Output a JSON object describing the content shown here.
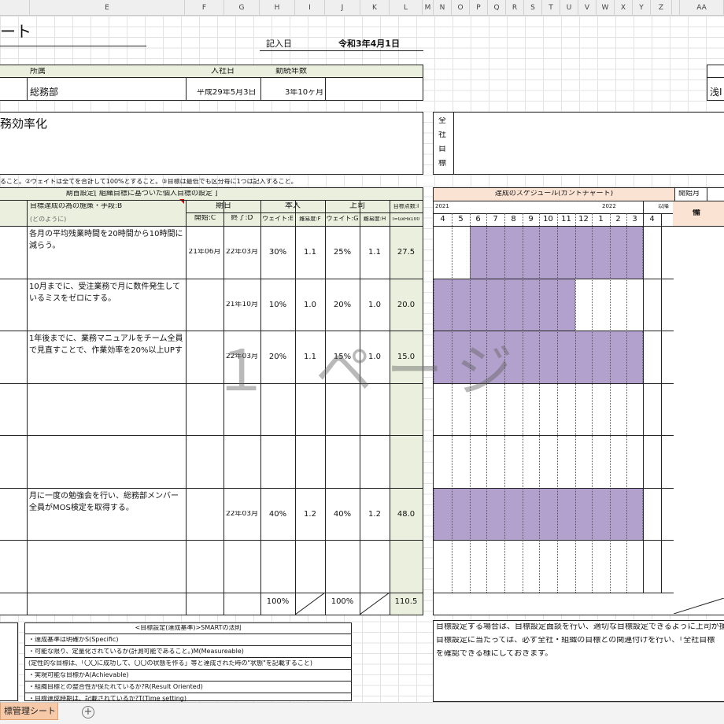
{
  "columns": [
    "E",
    "F",
    "G",
    "H",
    "I",
    "J",
    "K",
    "L",
    "M",
    "N",
    "O",
    "P",
    "Q",
    "R",
    "S",
    "T",
    "U",
    "V",
    "W",
    "X",
    "Y",
    "Z",
    "AA"
  ],
  "title_fragment": "ート",
  "record_date_label": "記入日",
  "record_date": "令和3年4月1日",
  "info": {
    "dept_label": "所属",
    "dept": "総務部",
    "join_label": "入社日",
    "join_date": "平成29年5月3日",
    "tenure_label": "勤続年数",
    "tenure": "3年10ヶ月",
    "right_fragment": "浅I"
  },
  "theme_fragment": "務効率化",
  "company_goal_label": [
    "全",
    "社",
    "目",
    "標"
  ],
  "note": "ること。②ウェイトは全てを合計して100%とすること。③目標は最低でも区分毎に1つは記入すること。",
  "table": {
    "period_title": "期首設定[ 組織目標に基づいた個人目標の設定 ]",
    "measure_label": "目標達成の為の施策・手段:B",
    "measure_sub": "(どのように)",
    "term_label": "期日",
    "start_label": "開始:C",
    "end_label": "終了:D",
    "self_label": "本人",
    "boss_label": "上司",
    "weight_e": "ウェイト:E",
    "diff_f": "難易度:F",
    "weight_g": "ウェイト:G",
    "diff_h": "難易度:H",
    "score_label": "目標点数:I",
    "score_formula": "I=GxHx100",
    "rows": [
      {
        "measure": "各月の平均残業時間を20時間から10時間に減らう。",
        "start": "21年06月",
        "end": "22年03月",
        "we": "30%",
        "df": "1.1",
        "wg": "25%",
        "dh": "1.1",
        "score": "27.5"
      },
      {
        "measure": "10月までに、受注業務で月に数件発生しているミスをゼロにする。",
        "start": "",
        "end": "21年10月",
        "we": "10%",
        "df": "1.0",
        "wg": "20%",
        "dh": "1.0",
        "score": "20.0"
      },
      {
        "measure": "1年後までに、業務マニュアルをチーム全員で見直すことで、作業効率を20%以上UPする。",
        "start": "",
        "end": "22年03月",
        "we": "20%",
        "df": "1.1",
        "wg": "15%",
        "dh": "1.0",
        "score": "15.0"
      },
      {
        "measure": "",
        "start": "",
        "end": "",
        "we": "",
        "df": "",
        "wg": "",
        "dh": "",
        "score": ""
      },
      {
        "measure": "",
        "start": "",
        "end": "",
        "we": "",
        "df": "",
        "wg": "",
        "dh": "",
        "score": ""
      },
      {
        "measure": "月に一度の勉強会を行い、総務部メンバー全員がMOS検定を取得する。",
        "start": "",
        "end": "22年03月",
        "we": "40%",
        "df": "1.2",
        "wg": "40%",
        "dh": "1.2",
        "score": "48.0"
      },
      {
        "measure": "",
        "start": "",
        "end": "",
        "we": "",
        "df": "",
        "wg": "",
        "dh": "",
        "score": ""
      }
    ],
    "total_we": "100%",
    "total_wg": "100%",
    "total_score": "110.5"
  },
  "gantt": {
    "title": "達成のスケジュール(ガントチャート)",
    "start_month_label": "開始月",
    "remarks_fragment": "備",
    "year1": "2021",
    "year2": "2022",
    "after_label": "以降",
    "months": [
      "4",
      "5",
      "6",
      "7",
      "8",
      "9",
      "10",
      "11",
      "12",
      "1",
      "2",
      "3",
      "4"
    ],
    "bars": [
      {
        "row": 0,
        "from": 2,
        "to": 11
      },
      {
        "row": 1,
        "from": 0,
        "to": 7
      },
      {
        "row": 2,
        "from": 0,
        "to": 11
      },
      {
        "row": 5,
        "from": 0,
        "to": 11
      }
    ]
  },
  "smart": {
    "title": "<目標設定(達成基準)>SMARTの法則",
    "items": [
      "・達成基準は明確かS(Specific)",
      "・可能な限り、定量化されているか(計測可能であること。)M(Measureable)",
      "(定性的な目標は、「〇〇に成功して、〇〇の状態を作る」等と達成された時の\"状態\"を記載すること)",
      "・実現可能な目標かA(Achievable)",
      "・組織目標との整合性が保たれているか?R(Result Oriented)",
      "・目標達成時期は、記載されているか?T(Time setting)"
    ]
  },
  "bottom_note": [
    "目標設定する場合は、目標設定面談を行い、適切な目標設定できるように上司が援助、指",
    "目標設定に当たっては、必ず全社・組織の目標との関連付けを行い、「全社目標",
    "を確認できる様にしておきます。"
  ],
  "watermark": "１ ページ",
  "sheet_tab": "標管理シート",
  "add_sheet": "+"
}
